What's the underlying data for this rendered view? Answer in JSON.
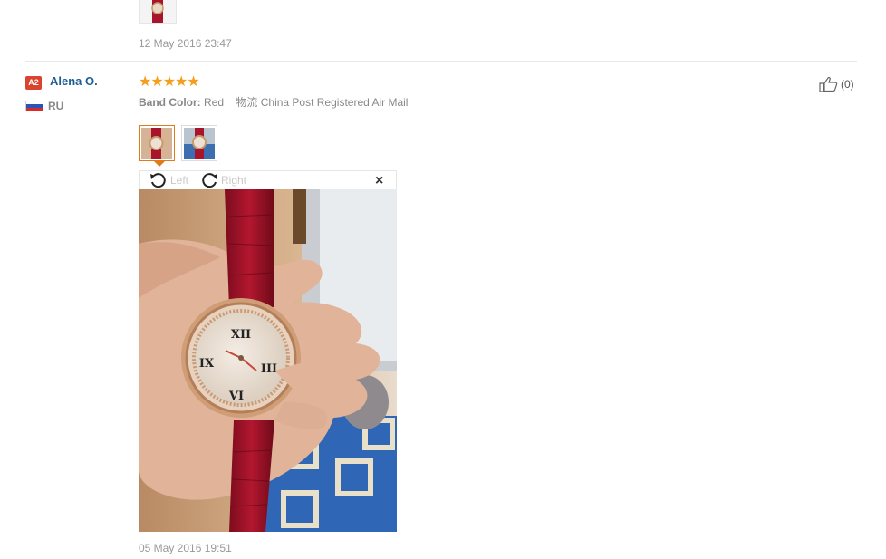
{
  "prev_review": {
    "date": "12 May 2016 23:47",
    "thumbnail_name": "watch-photo-thumbnail"
  },
  "review": {
    "badge": "A2",
    "user_name": "Alena O.",
    "country": "RU",
    "rating": 5,
    "stars": "★★★★★",
    "attr_label": "Band Color:",
    "attr_value": "Red",
    "shipping_label": "物流",
    "shipping_value": "China Post Registered Air Mail",
    "helpful_count": "(0)",
    "images": [
      "watch-photo-1",
      "watch-photo-2"
    ],
    "viewer": {
      "rotate_left": "Left",
      "rotate_right": "Right",
      "close": "×"
    },
    "date": "05 May 2016 19:51"
  },
  "colors": {
    "link": "#1d5d94",
    "star": "#f59e1b",
    "badge": "#d9432f",
    "active_thumb": "#e07b1a",
    "strap": "#a8142b"
  }
}
